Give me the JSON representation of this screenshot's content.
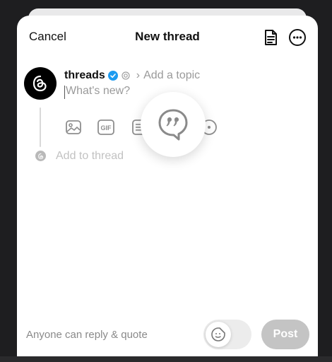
{
  "header": {
    "cancel_label": "Cancel",
    "title": "New thread",
    "drafts_icon": "drafts-icon",
    "more_icon": "more-options-icon"
  },
  "composer": {
    "username": "threads",
    "verified": true,
    "topic_placeholder": "Add a topic",
    "post_placeholder": "What's new?",
    "add_to_thread_label": "Add to thread",
    "attachments": [
      "image-icon",
      "gif-icon",
      "list-icon",
      "circle-icon"
    ]
  },
  "overlay": {
    "icon": "quote-icon"
  },
  "footer": {
    "reply_setting": "Anyone can reply & quote",
    "toggle_icon": "sticker-face-icon",
    "post_label": "Post"
  },
  "colors": {
    "verified": "#1d9bf0",
    "post_disabled": "#c4c4c4",
    "muted_text": "#9a9a9a"
  }
}
